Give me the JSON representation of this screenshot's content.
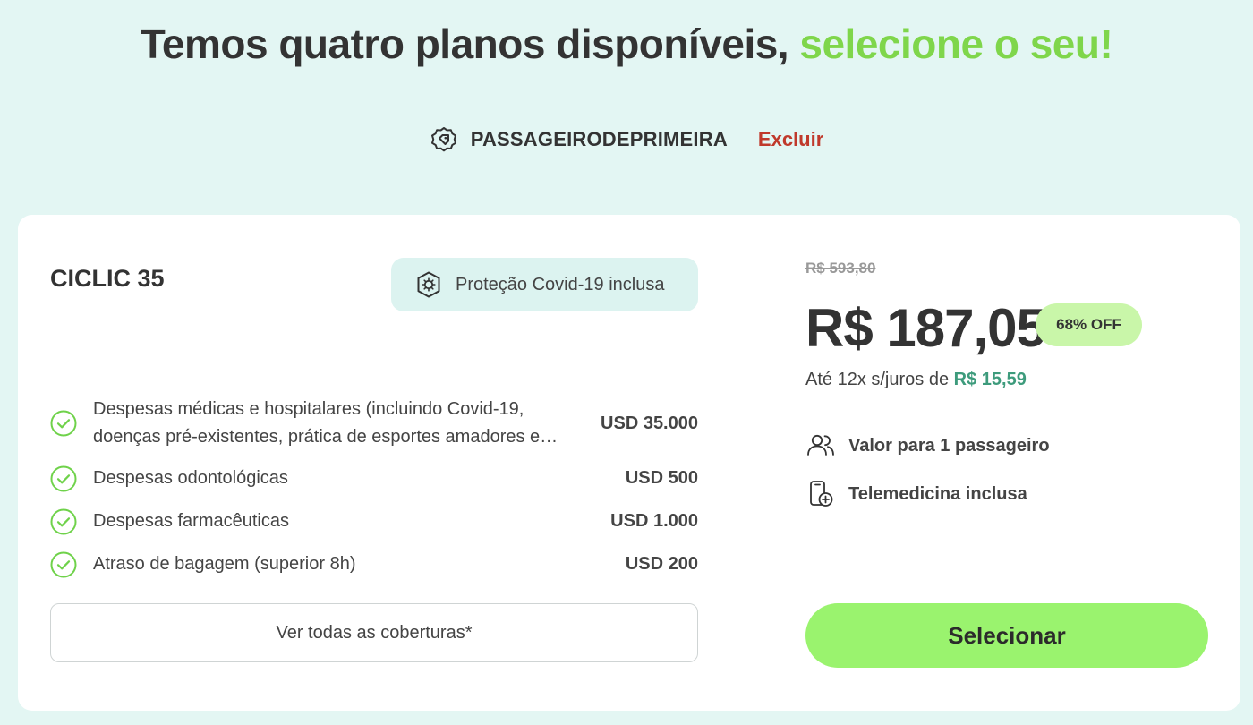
{
  "header": {
    "title_prefix": "Temos quatro planos disponíveis, ",
    "title_accent": "selecione o seu!"
  },
  "coupon": {
    "code": "PASSAGEIRODEPRIMEIRA",
    "remove_label": "Excluir",
    "icon": "tag-icon"
  },
  "plan": {
    "name": "CICLIC 35",
    "covid_badge": "Proteção Covid-19 inclusa",
    "coverages": [
      {
        "desc": "Despesas médicas e hospitalares (incluindo Covid-19, doenças pré-existentes, prática de esportes amadores e…",
        "amount": "USD 35.000"
      },
      {
        "desc": "Despesas odontológicas",
        "amount": "USD 500"
      },
      {
        "desc": "Despesas farmacêuticas",
        "amount": "USD 1.000"
      },
      {
        "desc": "Atraso de bagagem (superior 8h)",
        "amount": "USD 200"
      }
    ],
    "all_coverages_label": "Ver todas as coberturas*"
  },
  "pricing": {
    "old_price": "R$ 593,80",
    "price": "R$ 187,05",
    "discount": "68% OFF",
    "installments_prefix": "Até 12x s/juros de ",
    "installments_value": "R$ 15,59",
    "features": [
      {
        "icon": "users-icon",
        "label": "Valor para 1 passageiro"
      },
      {
        "icon": "telemedicine-icon",
        "label": "Telemedicina inclusa"
      }
    ],
    "select_label": "Selecionar"
  },
  "colors": {
    "background": "#e3f6f3",
    "accent_green": "#7fd64b",
    "button_green": "#9af36e",
    "remove_red": "#c0392b",
    "installment_teal": "#3d9b7c"
  }
}
